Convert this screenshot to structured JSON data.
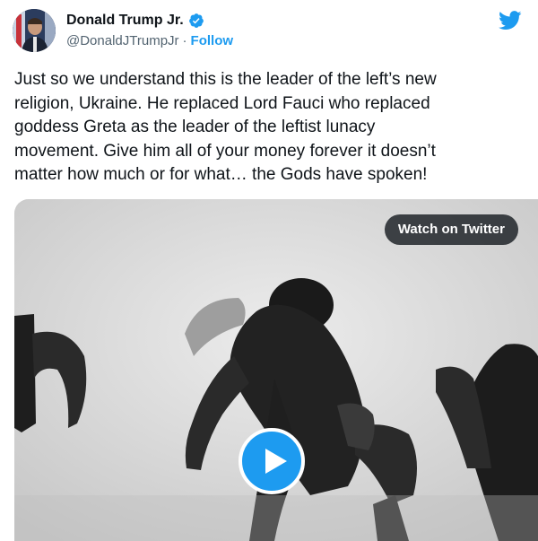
{
  "author": {
    "display_name": "Donald Trump Jr.",
    "handle": "@DonaldJTrumpJr",
    "separator": "·",
    "follow_label": "Follow"
  },
  "tweet": {
    "text": "Just so we understand this is the leader of the left’s new\nreligion, Ukraine. He replaced Lord Fauci who replaced\ngoddess Greta as the leader of the leftist lunacy\nmovement. Give him all of your money forever it doesn’t\nmatter how much or for what… the Gods have spoken!"
  },
  "media": {
    "watch_label": "Watch on Twitter",
    "type": "video"
  },
  "colors": {
    "brand_blue": "#1d9bf0",
    "text_primary": "#0f1419",
    "text_secondary": "#536471"
  },
  "icons": {
    "verified": "verified-badge-icon",
    "logo": "twitter-bird-icon",
    "play": "play-icon"
  }
}
